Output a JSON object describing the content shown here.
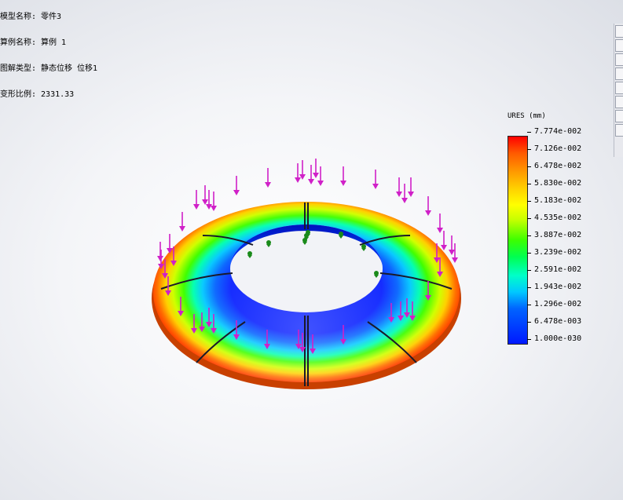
{
  "info": {
    "lines": [
      "模型名称: 零件3",
      "算例名称: 算例 1",
      "图解类型: 静态位移 位移1",
      "变形比例: 2331.33"
    ]
  },
  "legend": {
    "title": "URES (mm)",
    "labels": [
      "7.774e-002",
      "7.126e-002",
      "6.478e-002",
      "5.830e-002",
      "5.183e-002",
      "4.535e-002",
      "3.887e-002",
      "3.239e-002",
      "2.591e-002",
      "1.943e-002",
      "1.296e-002",
      "6.478e-003",
      "1.000e-030"
    ]
  },
  "colors": {
    "load_arrow": "#d020c8",
    "fixture": "#1a8a1a"
  },
  "toolbar": {
    "icons": [
      "toolbar-icon",
      "toolbar-icon",
      "toolbar-icon",
      "toolbar-icon",
      "toolbar-icon",
      "toolbar-icon",
      "toolbar-icon",
      "toolbar-icon"
    ]
  }
}
